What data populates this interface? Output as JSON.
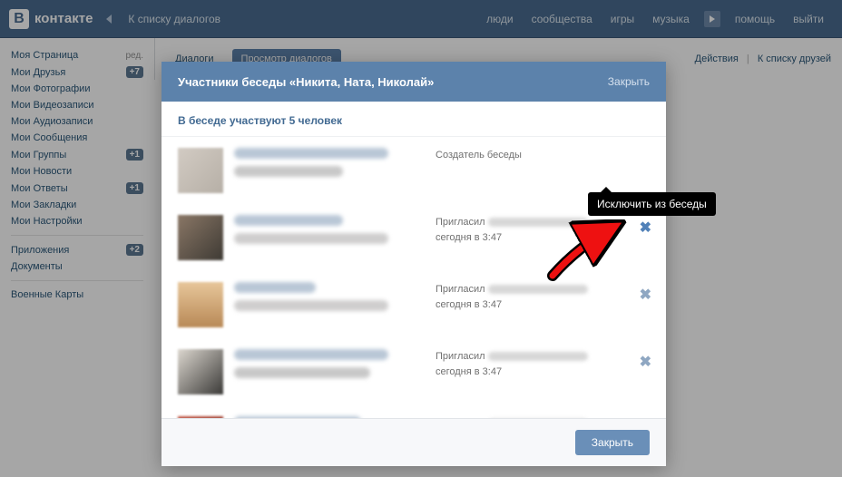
{
  "topbar": {
    "brand": "контакте",
    "back": "К списку диалогов",
    "links": {
      "people": "люди",
      "communities": "сообщества",
      "games": "игры",
      "music": "музыка",
      "help": "помощь",
      "logout": "выйти"
    }
  },
  "sidebar": {
    "edit": "ред.",
    "items": [
      {
        "label": "Моя Страница",
        "edit": true
      },
      {
        "label": "Мои Друзья",
        "count": "+7"
      },
      {
        "label": "Мои Фотографии"
      },
      {
        "label": "Мои Видеозаписи"
      },
      {
        "label": "Мои Аудиозаписи"
      },
      {
        "label": "Мои Сообщения"
      },
      {
        "label": "Мои Группы",
        "count": "+1"
      },
      {
        "label": "Мои Новости"
      },
      {
        "label": "Мои Ответы",
        "count": "+1"
      },
      {
        "label": "Мои Закладки"
      },
      {
        "label": "Мои Настройки"
      }
    ],
    "secondary": [
      {
        "label": "Приложения",
        "count": "+2"
      },
      {
        "label": "Документы"
      }
    ],
    "tertiary": [
      {
        "label": "Военные Карты"
      }
    ]
  },
  "tabs": {
    "dialogs": "Диалоги",
    "view": "Просмотр диалогов",
    "actions": "Действия",
    "friends": "К списку друзей"
  },
  "modal": {
    "title": "Участники беседы «Никита, Ната, Николай»",
    "close": "Закрыть",
    "subtitle": "В беседе участвуют 5 человек",
    "creator": "Создатель беседы",
    "invited": "Пригласил",
    "time": "сегодня в 3:47",
    "footer_close": "Закрыть"
  },
  "tooltip": "Исключить из беседы"
}
